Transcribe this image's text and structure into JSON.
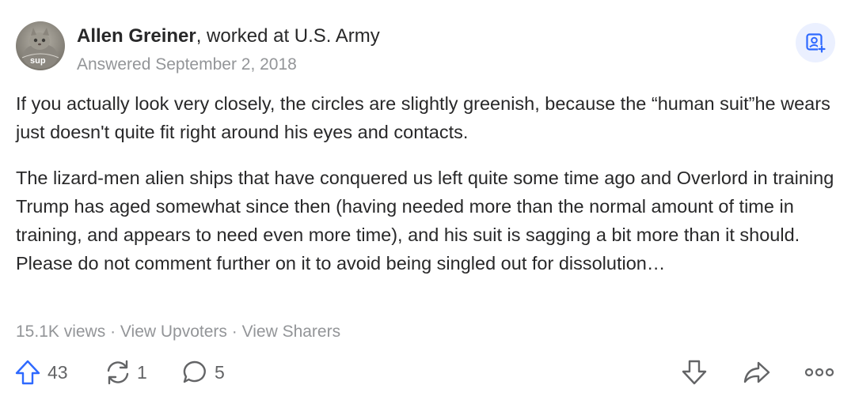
{
  "author": {
    "name": "Allen Greiner",
    "credential": ", worked at U.S. Army",
    "avatar_text": "sup"
  },
  "answer": {
    "date": "Answered September 2, 2018",
    "paragraphs": [
      "If you actually look very closely, the circles are slightly greenish, because the “human suit”he wears just doesn't quite fit right around his eyes and contacts.",
      "The lizard-men alien ships that have conquered us left quite some time ago and Overlord in training Trump has aged somewhat since then (having needed more than the normal amount of time in training, and appears to need even more time), and his suit is sagging a bit more than it should. Please do not comment further on it to avoid being singled out for dissolution…"
    ]
  },
  "meta": {
    "views": "15.1K views",
    "separator": " · ",
    "view_upvoters": "View Upvoters",
    "view_sharers": "View Sharers"
  },
  "actions": {
    "upvotes": "43",
    "shares": "1",
    "comments": "5"
  },
  "icons": {
    "upvote": "upvote-arrow-icon",
    "share": "reshare-icon",
    "comment": "comment-bubble-icon",
    "downvote": "downvote-arrow-icon",
    "forward": "share-forward-icon",
    "more": "more-dots-icon",
    "follow": "follow-user-icon"
  },
  "colors": {
    "upvote_blue": "#2e69ff",
    "text_primary": "#282829",
    "text_secondary": "#939598",
    "icon_gray": "#636466",
    "follow_bg": "#ebf0ff"
  }
}
